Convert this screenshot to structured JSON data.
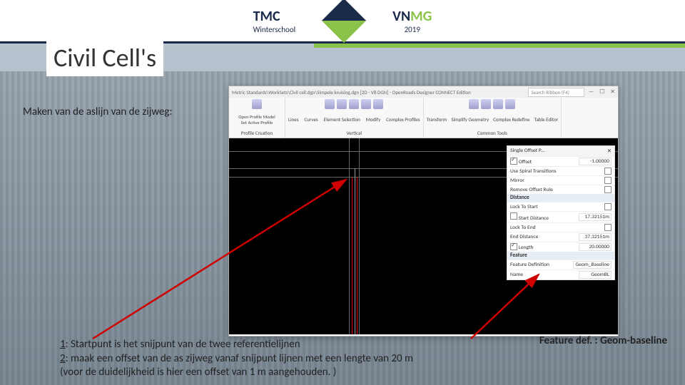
{
  "header": {
    "tmc_name": "TMC",
    "tmc_sub": "Winterschool",
    "vnmg_vn": "VN",
    "vnmg_mg": "MG",
    "vnmg_year": "2019"
  },
  "title": "Civil Cell's",
  "step_text": "Maken van de aslijn van de zijweg:",
  "app": {
    "titlebar": "Metric Standards\\WorkSets\\Civil cell.dgn\\Simpele kruising.dgn [2D - V8 DGN] - OpenRoads Designer CONNECT Edition",
    "search_placeholder": "Search Ribbon (F4)",
    "ribbon": {
      "g1_top": "Open Profile Model",
      "g1_bot": "Set Active Profile",
      "g1_label": "Profile Creation",
      "g2_items": [
        "Lines",
        "Curves",
        "Element Selection",
        "Modify",
        "Complex Profiles"
      ],
      "g2_label": "Vertical",
      "g3_items": [
        "Transform",
        "Simplify Geometry",
        "Complex Redefine",
        "Table Editor"
      ],
      "g3_label": "Common Tools"
    },
    "panel": {
      "title": "Single Offset P...",
      "offset_label": "Offset",
      "offset_val": "-1.00000",
      "spiral_label": "Use Spiral Transitions",
      "mirror_label": "Mirror",
      "remove_label": "Remove Offset Rule",
      "distance_label": "Distance",
      "lockstart_label": "Lock To Start",
      "startdist_label": "Start Distance",
      "startdist_val": "17.32151m",
      "lockend_label": "Lock To End",
      "enddist_label": "End Distance",
      "enddist_val": "37.32151m",
      "length_label": "Length",
      "length_val": "20.00000",
      "feature_section": "Feature",
      "featdef_label": "Feature Definition",
      "featdef_val": "Geom_Baseline",
      "name_label": "Name",
      "name_val": "GeomBL"
    }
  },
  "feature_def_note": "Feature def. : Geom-baseline",
  "steps": {
    "s1_prefix": "1",
    "s1_text": ": Startpunt is het snijpunt van de twee referentielijnen",
    "s2_prefix": "2",
    "s2_text": ": maak een offset van de as zijweg vanaf snijpunt lijnen met een lengte van 20 m",
    "s3_text": "(voor de duidelijkheid is hier een offset van 1 m aangehouden. )"
  }
}
